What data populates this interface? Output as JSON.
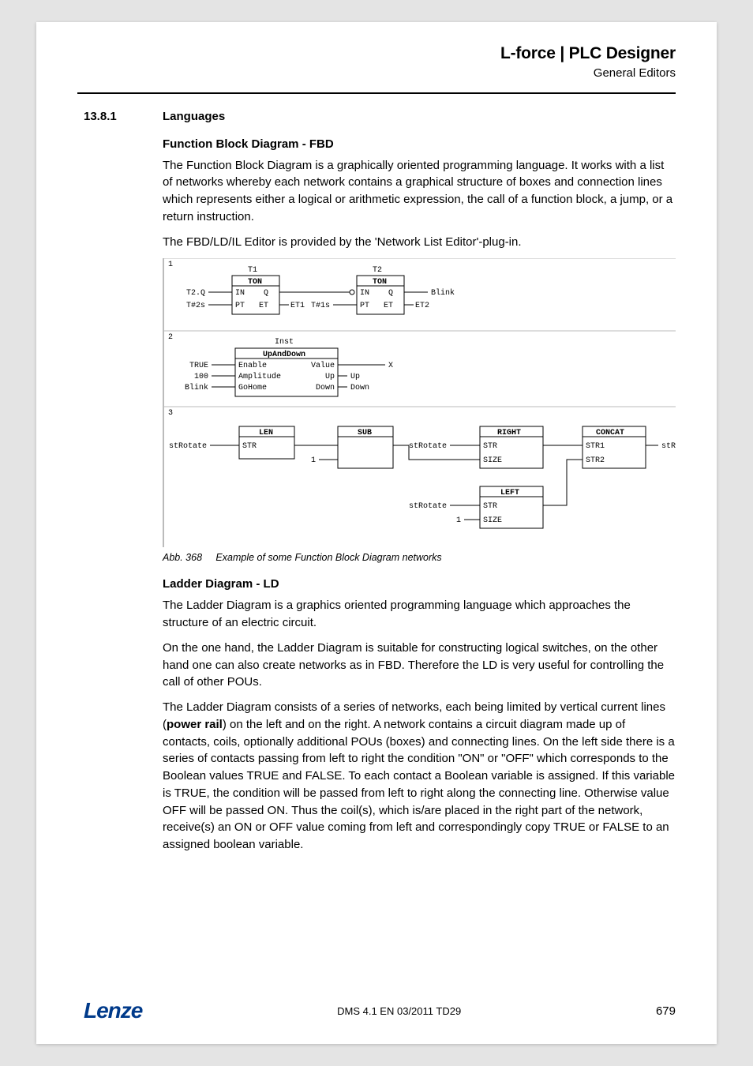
{
  "header": {
    "brand": "L-force | PLC Designer",
    "subhead": "General Editors"
  },
  "section": {
    "number": "13.8.1",
    "title": "Languages"
  },
  "fbd": {
    "title": "Function Block Diagram - FBD",
    "p1": "The Function Block Diagram is a graphically oriented programming language. It works with a list of networks whereby each network contains a graphical structure of boxes and connection lines which represents either a logical or arithmetic expression, the call of a function block, a jump, or a return instruction.",
    "p2": "The FBD/LD/IL Editor is provided by the 'Network List Editor'-plug-in."
  },
  "diagram": {
    "net1": {
      "t1_inst": "T1",
      "t1_type": "TON",
      "t1_in_sig": "T2.Q",
      "t1_pt_sig": "T#2s",
      "t1_in": "IN",
      "t1_pt": "PT",
      "t1_q": "Q",
      "t1_et": "ET",
      "t1_et_sig": "ET1",
      "t2_inst": "T2",
      "t2_type": "TON",
      "t2_pt_sig": "T#1s",
      "t2_in": "IN",
      "t2_pt": "PT",
      "t2_q": "Q",
      "t2_et": "ET",
      "t2_q_sig": "Blink",
      "t2_et_sig": "ET2"
    },
    "net2": {
      "inst": "Inst",
      "type": "UpAndDown",
      "enable_sig": "TRUE",
      "amp_sig": "100",
      "gohome_sig": "Blink",
      "enable": "Enable",
      "amp": "Amplitude",
      "gohome": "GoHome",
      "value": "Value",
      "up": "Up",
      "down": "Down",
      "value_sig": "X",
      "up_sig": "Up",
      "down_sig": "Down"
    },
    "net3": {
      "len": "LEN",
      "len_in": "STR",
      "len_sig": "stRotate",
      "sub": "SUB",
      "sub_b": "1",
      "right": "RIGHT",
      "right_str": "STR",
      "right_size": "SIZE",
      "right_sig": "stRotate",
      "concat": "CONCAT",
      "concat_s1": "STR1",
      "concat_s2": "STR2",
      "concat_sig": "stRotate",
      "left": "LEFT",
      "left_str": "STR",
      "left_size": "SIZE",
      "left_sig": "stRotate",
      "left_size_sig": "1"
    }
  },
  "caption": {
    "num": "Abb. 368",
    "text": "Example of some Function Block Diagram networks"
  },
  "ld": {
    "title": "Ladder Diagram - LD",
    "p1": "The Ladder Diagram is a graphics oriented programming language which approaches the structure of an electric circuit.",
    "p2": "On the one hand, the Ladder Diagram is suitable for constructing logical switches, on the other hand one can also create networks as in FBD. Therefore the LD is very useful for controlling the call of other POUs.",
    "p3_a": "The Ladder Diagram consists of a series of networks, each being limited by vertical current lines (",
    "p3_bold": "power rail",
    "p3_b": ") on the left and on the right. A network contains a circuit diagram made up of contacts, coils, optionally additional POUs (boxes) and connecting lines. On the left side there is a series of contacts passing  from left to right the condition \"ON\" or \"OFF\" which corresponds to the Boolean values TRUE and FALSE. To each contact a Boolean variable is assigned. If this variable is TRUE, the condition will be passed from left to right along the connecting line. Otherwise value OFF will be passed ON. Thus the coil(s), which is/are placed in the right part of the network, receive(s) an ON or OFF value coming from left and correspondingly copy TRUE or FALSE to an assigned boolean variable."
  },
  "footer": {
    "logo": "Lenze",
    "doc_id": "DMS 4.1 EN 03/2011 TD29",
    "page": "679"
  }
}
